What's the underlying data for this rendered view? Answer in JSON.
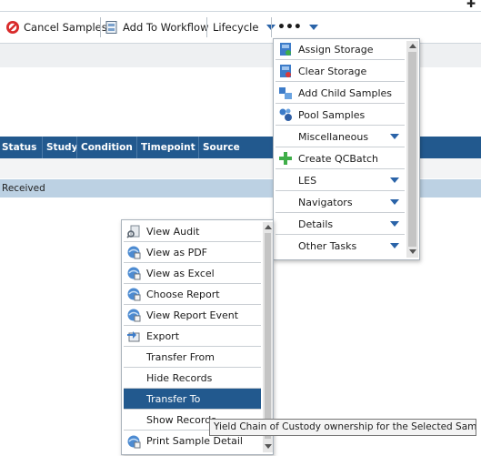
{
  "toolbar": {
    "cancel_samples": "Cancel Samples",
    "add_to_workflow": "Add To Workflow",
    "lifecycle": "Lifecycle",
    "more": "•••"
  },
  "grid": {
    "columns": [
      "Status",
      "Study",
      "Condition",
      "Timepoint",
      "Source"
    ],
    "received_row_status": "Received"
  },
  "more_menu": {
    "items": [
      {
        "label": "Assign Storage",
        "icon": "assign-storage-icon"
      },
      {
        "label": "Clear Storage",
        "icon": "clear-storage-icon"
      },
      {
        "label": "Add Child Samples",
        "icon": "add-child-samples-icon"
      },
      {
        "label": "Pool Samples",
        "icon": "pool-samples-icon"
      },
      {
        "label": "Miscellaneous",
        "icon": "",
        "submenu": true
      },
      {
        "label": "Create QCBatch",
        "icon": "green-plus-icon"
      },
      {
        "label": "LES",
        "icon": "",
        "submenu": true
      },
      {
        "label": "Navigators",
        "icon": "",
        "submenu": true
      },
      {
        "label": "Details",
        "icon": "",
        "submenu": true
      },
      {
        "label": "Other Tasks",
        "icon": "",
        "submenu": true
      }
    ]
  },
  "context_menu": {
    "items": [
      {
        "label": "View Audit",
        "icon": "view-audit-icon"
      },
      {
        "label": "View as PDF",
        "icon": "report-icon"
      },
      {
        "label": "View as Excel",
        "icon": "report-icon"
      },
      {
        "label": "Choose Report",
        "icon": "report-icon"
      },
      {
        "label": "View Report Event",
        "icon": "report-icon"
      },
      {
        "label": "Export",
        "icon": "export-icon"
      },
      {
        "label": "Transfer From",
        "icon": ""
      },
      {
        "label": "Hide Records",
        "icon": ""
      },
      {
        "label": "Transfer To",
        "icon": "",
        "selected": true
      },
      {
        "label": "Show Records",
        "icon": ""
      },
      {
        "label": "Print Sample Detail",
        "icon": "report-icon"
      }
    ]
  },
  "tooltip": "Yield Chain of Custody ownership for the Selected Sample(s)",
  "colors": {
    "header_blue": "#22598e",
    "selected_row": "#bcd1e3",
    "accent_arrow": "#2a63a8"
  }
}
